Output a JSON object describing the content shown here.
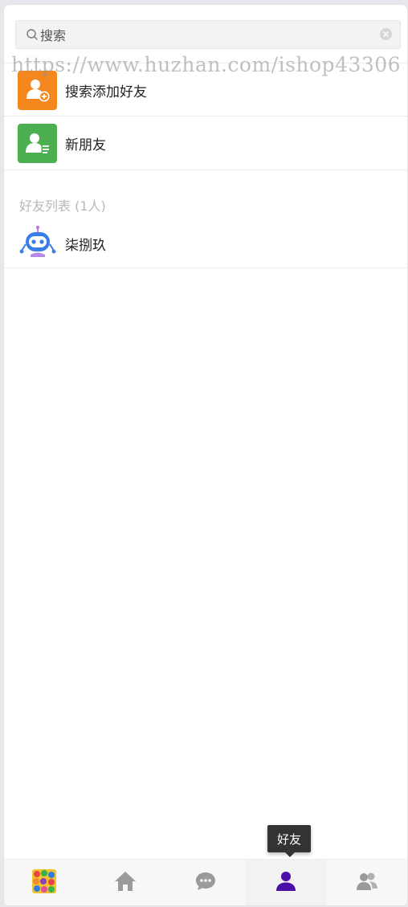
{
  "search": {
    "placeholder": "搜索"
  },
  "watermark": "https://www.huzhan.com/ishop43306",
  "actions": [
    {
      "label": "搜索添加好友",
      "icon": "add-user-icon",
      "color": "#f5871f"
    },
    {
      "label": "新朋友",
      "icon": "new-friend-icon",
      "color": "#4caf50"
    }
  ],
  "friends": {
    "section_title": "好友列表 (1人)",
    "items": [
      {
        "name": "柒捌玖",
        "icon": "robot-avatar-icon"
      }
    ]
  },
  "tabbar": {
    "tabs": [
      {
        "name": "apps",
        "icon": "colorful-grid-icon"
      },
      {
        "name": "home",
        "icon": "home-icon"
      },
      {
        "name": "messages",
        "icon": "chat-bubble-icon"
      },
      {
        "name": "friends",
        "icon": "user-icon",
        "active": true
      },
      {
        "name": "groups",
        "icon": "group-icon"
      }
    ],
    "tooltip": "好友",
    "active_color": "#4b0fa8",
    "inactive_color": "#9a9a9a"
  }
}
